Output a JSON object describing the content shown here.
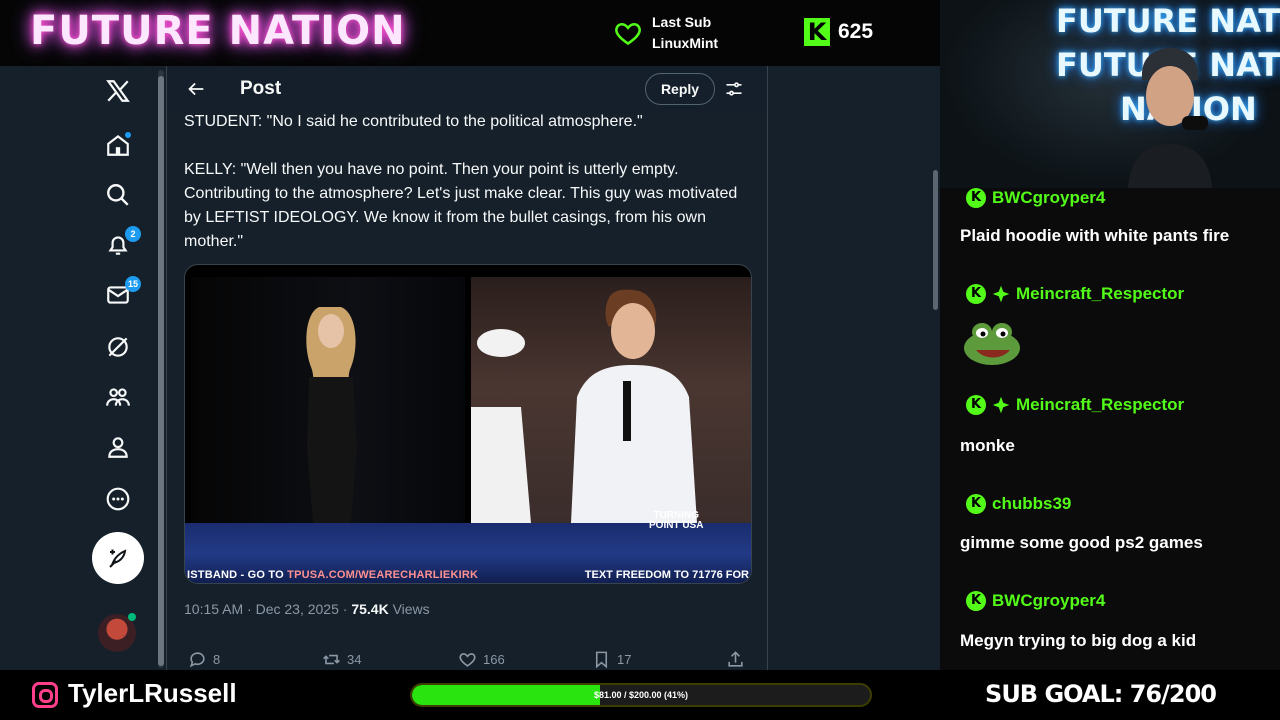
{
  "overlay": {
    "brand": "FUTURE NATION",
    "last_sub_label": "Last Sub",
    "last_sub_name": "LinuxMint",
    "kick_icon": "K",
    "follower_count": "625",
    "handle": "TylerLRussell",
    "goal_text": "$81.00 / $200.00 (41%)",
    "goal_progress": 0.41,
    "sub_goal": "SUB GOAL: 76/200",
    "accent": "#53fc18",
    "cam_neon": [
      "FUTURE NATION",
      "FUTURE NATION",
      "NATION"
    ]
  },
  "sidebar": {
    "notifications_badge": "2",
    "messages_badge": "15",
    "icons": [
      "x-logo-icon",
      "home-icon",
      "search-icon",
      "bell-icon",
      "mail-icon",
      "grok-icon",
      "communities-icon",
      "profile-icon",
      "more-icon",
      "compose-icon"
    ]
  },
  "post": {
    "header_title": "Post",
    "reply_label": "Reply",
    "text_lines": [
      "STUDENT: \"No I said he contributed to the political atmosphere.\"",
      "KELLY: \"Well then you have no point. Then your point is utterly empty. Contributing to the atmosphere?  Let's just make clear. This guy was motivated by LEFTIST IDEOLOGY. We know it from the bullet casings, from his own mother.\""
    ],
    "video": {
      "ticker_left_a": "ISTBAND - GO TO ",
      "ticker_left_b": "TPUSA.COM/WEARECHARLIEKIRK",
      "ticker_right": "TEXT FREEDOM TO 71776 FOR",
      "logo_l1": "TURNING",
      "logo_l2": "POINT USA"
    },
    "timestamp": "10:15 AM · Dec 23, 2025 · ",
    "views_count": "75.4K",
    "views_label": " Views",
    "actions": {
      "replies": "8",
      "reposts": "34",
      "likes": "166",
      "bookmarks": "17"
    }
  },
  "chat": {
    "messages": [
      {
        "user": "BWCgroyper4",
        "text": "Plaid hoodie with white pants fire"
      },
      {
        "user": "Meincraft_Respector",
        "text": ""
      },
      {
        "user": "Meincraft_Respector",
        "text": "monke"
      },
      {
        "user": "chubbs39",
        "text": "gimme some good ps2 games"
      },
      {
        "user": "BWCgroyper4",
        "text": "Megyn trying to big dog a kid"
      }
    ]
  }
}
